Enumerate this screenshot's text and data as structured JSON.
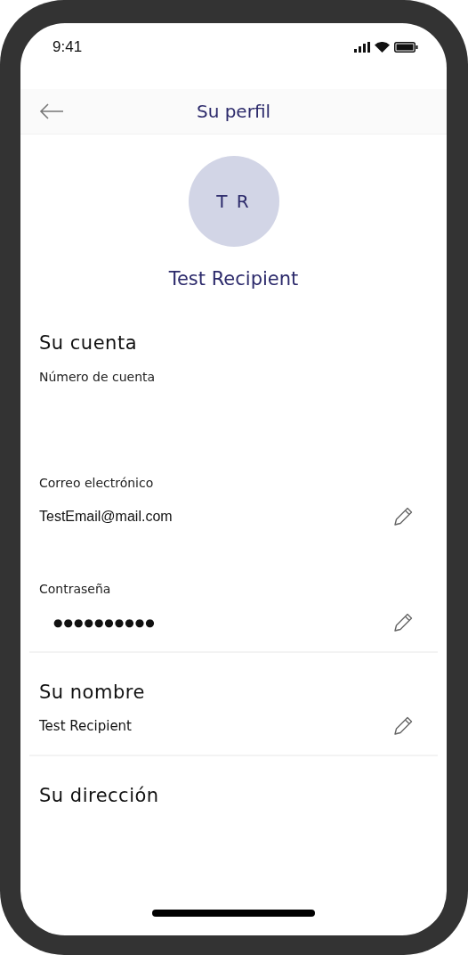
{
  "status_bar": {
    "time": "9:41"
  },
  "header": {
    "title": "Su perfil"
  },
  "profile": {
    "initials": "T R",
    "name": "Test Recipient"
  },
  "sections": [
    {
      "title": "Su cuenta",
      "fields": [
        {
          "label": "Número de cuenta",
          "editable": false
        },
        {
          "label": "Correo electrónico",
          "value": "TestEmail@mail.com",
          "kind": "text",
          "editable": true
        },
        {
          "label": "Contraseña",
          "value": "●●●●●●●●●●",
          "kind": "password",
          "editable": true
        }
      ]
    },
    {
      "title": "Su nombre",
      "fields": [
        {
          "value": "Test Recipient",
          "kind": "text",
          "editable": true
        }
      ]
    },
    {
      "title": "Su dirección"
    }
  ]
}
